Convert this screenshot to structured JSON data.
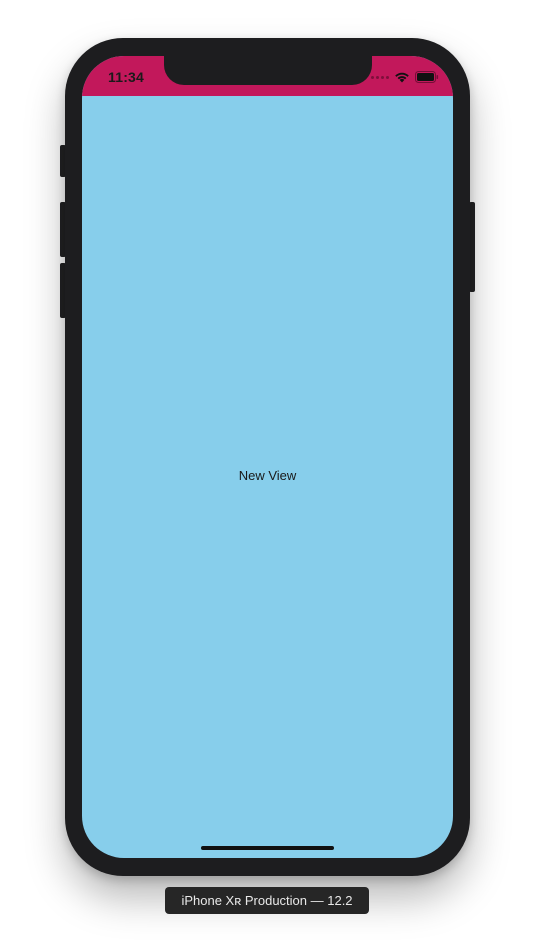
{
  "device": {
    "caption": "iPhone Xʀ Production — 12.2"
  },
  "status_bar": {
    "time": "11:34",
    "background_color": "#c2185b"
  },
  "screen": {
    "background_color": "#87ceeb",
    "label": "New View"
  },
  "icons": {
    "signal": "signal-dots-icon",
    "wifi": "wifi-icon",
    "battery": "battery-icon"
  }
}
